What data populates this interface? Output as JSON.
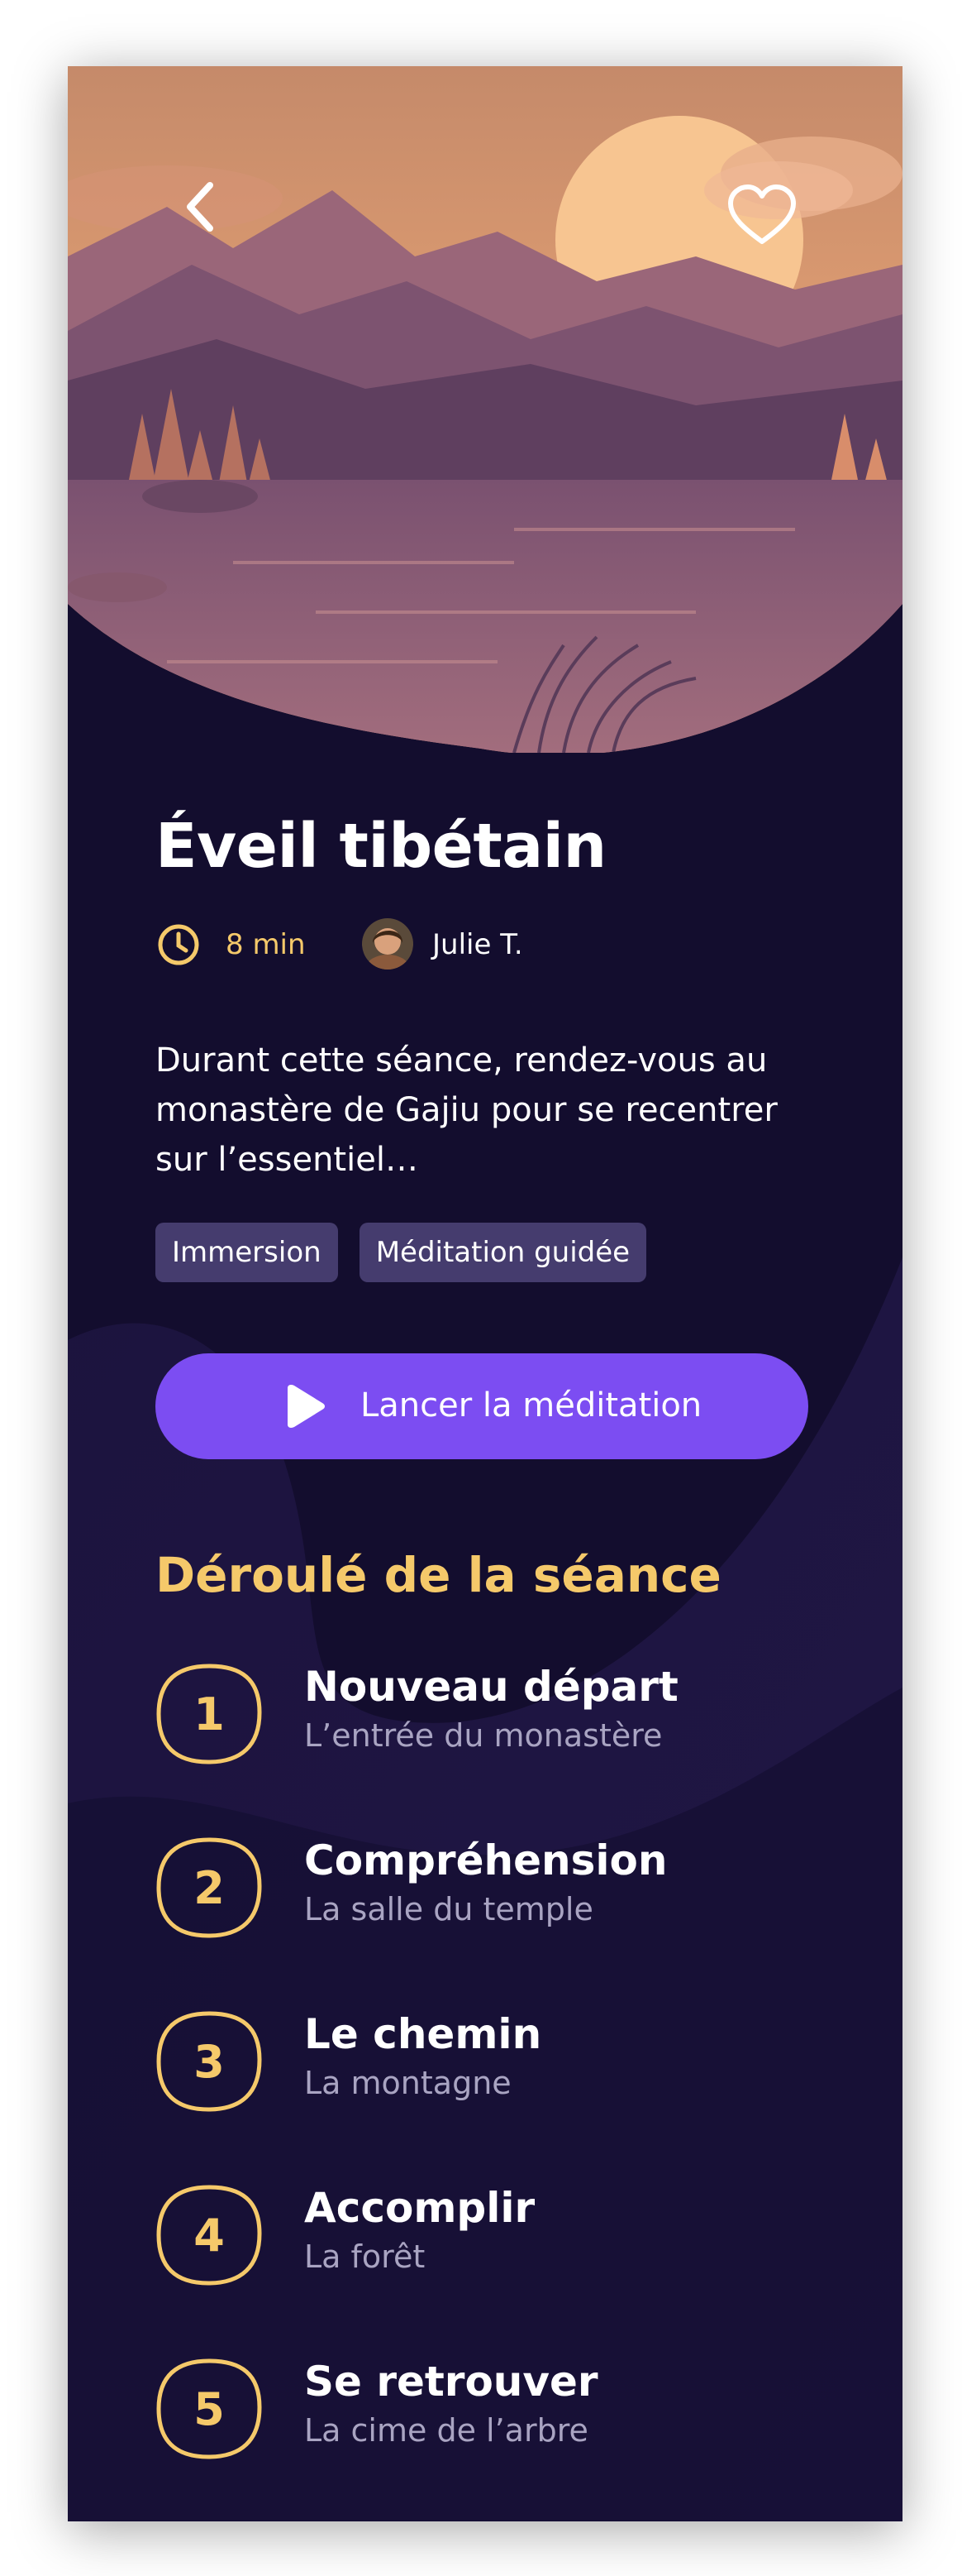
{
  "session": {
    "title": "Éveil tibétain",
    "duration": "8 min",
    "author": "Julie T.",
    "description_lines": [
      "Durant cette séance, rendez-vous au",
      "monastère de Gajiu pour se recentrer",
      "sur l’essentiel…"
    ],
    "tags": [
      "Immersion",
      "Méditation guidée"
    ]
  },
  "cta": {
    "label": "Lancer la méditation"
  },
  "section": {
    "title": "Déroulé de la séance"
  },
  "steps": [
    {
      "number": "1",
      "title": "Nouveau départ",
      "subtitle": "L’entrée du monastère"
    },
    {
      "number": "2",
      "title": "Compréhension",
      "subtitle": "La salle du temple"
    },
    {
      "number": "3",
      "title": "Le chemin",
      "subtitle": "La montagne"
    },
    {
      "number": "4",
      "title": "Accomplir",
      "subtitle": "La forêt"
    },
    {
      "number": "5",
      "title": "Se retrouver",
      "subtitle": "La cime de l’arbre"
    }
  ],
  "icons": {
    "back": "chevron-left-icon",
    "favorite": "heart-icon",
    "duration": "clock-icon",
    "play": "play-icon"
  },
  "colors": {
    "background": "#130d2e",
    "accent": "#f5c96a",
    "button": "#7c4df2",
    "tag": "#453c6e"
  }
}
